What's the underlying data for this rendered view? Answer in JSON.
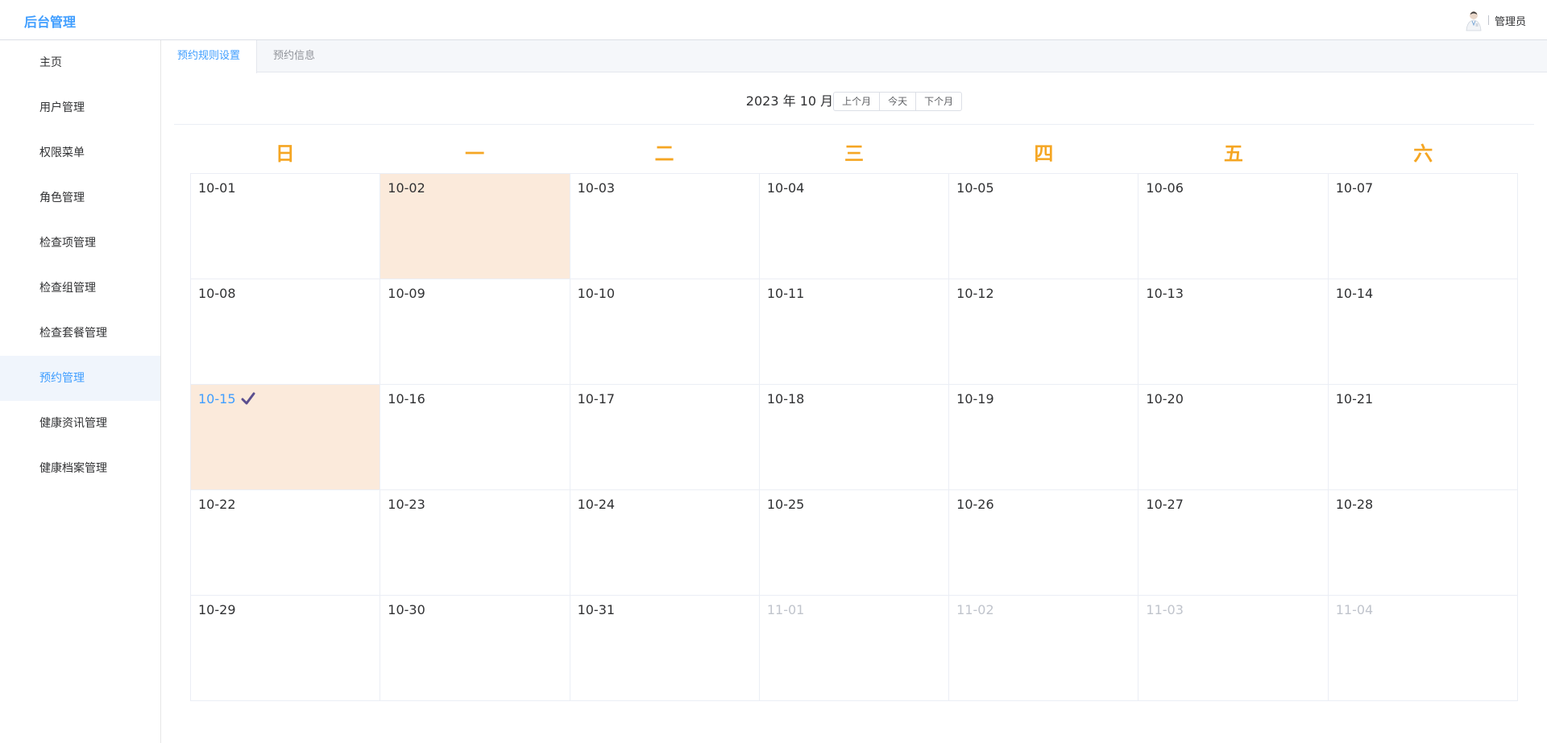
{
  "header": {
    "brand": "后台管理",
    "user_name": "管理员"
  },
  "sidebar": {
    "items": [
      {
        "label": "主页"
      },
      {
        "label": "用户管理"
      },
      {
        "label": "权限菜单"
      },
      {
        "label": "角色管理"
      },
      {
        "label": "检查项管理"
      },
      {
        "label": "检查组管理"
      },
      {
        "label": "检查套餐管理"
      },
      {
        "label": "预约管理"
      },
      {
        "label": "健康资讯管理"
      },
      {
        "label": "健康档案管理"
      }
    ],
    "active": "预约管理"
  },
  "tabs": [
    {
      "label": "预约规则设置"
    },
    {
      "label": "预约信息"
    }
  ],
  "calendar": {
    "title": "2023 年 10 月",
    "buttons": {
      "prev": "上个月",
      "today": "今天",
      "next": "下个月"
    },
    "weekdays": [
      "日",
      "一",
      "二",
      "三",
      "四",
      "五",
      "六"
    ],
    "days": [
      "10-01",
      "10-02",
      "10-03",
      "10-04",
      "10-05",
      "10-06",
      "10-07",
      "10-08",
      "10-09",
      "10-10",
      "10-11",
      "10-12",
      "10-13",
      "10-14",
      "10-15",
      "10-16",
      "10-17",
      "10-18",
      "10-19",
      "10-20",
      "10-21",
      "10-22",
      "10-23",
      "10-24",
      "10-25",
      "10-26",
      "10-27",
      "10-28",
      "10-29",
      "10-30",
      "10-31",
      "11-01",
      "11-02",
      "11-03",
      "11-04"
    ],
    "highlighted": [
      "10-02",
      "10-15"
    ],
    "selected": "10-15",
    "other_month": [
      "11-01",
      "11-02",
      "11-03",
      "11-04"
    ],
    "highlight_color": "#fbeadb",
    "weekday_color": "#f5a623",
    "check_icon": "checkmark-icon"
  }
}
